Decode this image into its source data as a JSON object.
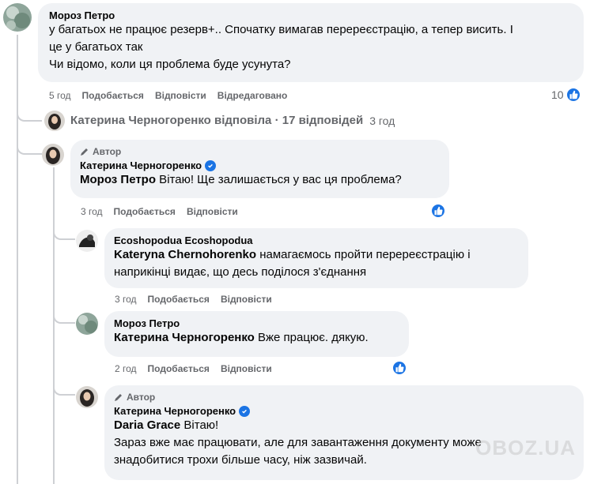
{
  "comment1": {
    "author": "Мороз Петро",
    "line1": "у багатьох не працює резерв+.. Спочатку вимагав перереєстрацію, а тепер висить. І",
    "line2": "це у багатьох так",
    "line3": "Чи відомо, коли ця проблема буде усунута?",
    "time": "5 год",
    "like": "Подобається",
    "reply": "Відповісти",
    "edited": "Відредаговано",
    "likes_count": "10"
  },
  "replies_summary": {
    "text": "Катерина Черногоренко відповіла · 17 відповідей",
    "time": "3 год"
  },
  "reply1": {
    "badge": "Автор",
    "author": "Катерина Черногоренко",
    "mention": "Мороз Петро",
    "text": " Вітаю! Ще залишається у вас ця проблема?",
    "time": "3 год",
    "like": "Подобається",
    "reply": "Відповісти"
  },
  "reply2": {
    "author": "Ecoshopodua Ecoshopodua",
    "mention": "Kateryna Chernohorenko",
    "text1": " намагаємось пройти перереєстрацію і",
    "text2": "наприкінці видає, що десь поділося з'єднання",
    "time": "3 год",
    "like": "Подобається",
    "reply": "Відповісти"
  },
  "reply3": {
    "author": "Мороз Петро",
    "mention": "Катерина Черногоренко",
    "text": " Вже працює. дякую.",
    "time": "2 год",
    "like": "Подобається",
    "reply": "Відповісти"
  },
  "reply4": {
    "badge": "Автор",
    "author": "Катерина Черногоренко",
    "mention": "Daria Grace",
    "text1": " Вітаю!",
    "text2": "Зараз вже має працювати, але для завантаження документу може",
    "text3": "знадобитися трохи більше часу, ніж зазвичай."
  },
  "watermark": "OBOZ.UA",
  "colors": {
    "accent": "#1b74e4",
    "bubble": "#f0f2f5",
    "meta": "#65676b"
  }
}
